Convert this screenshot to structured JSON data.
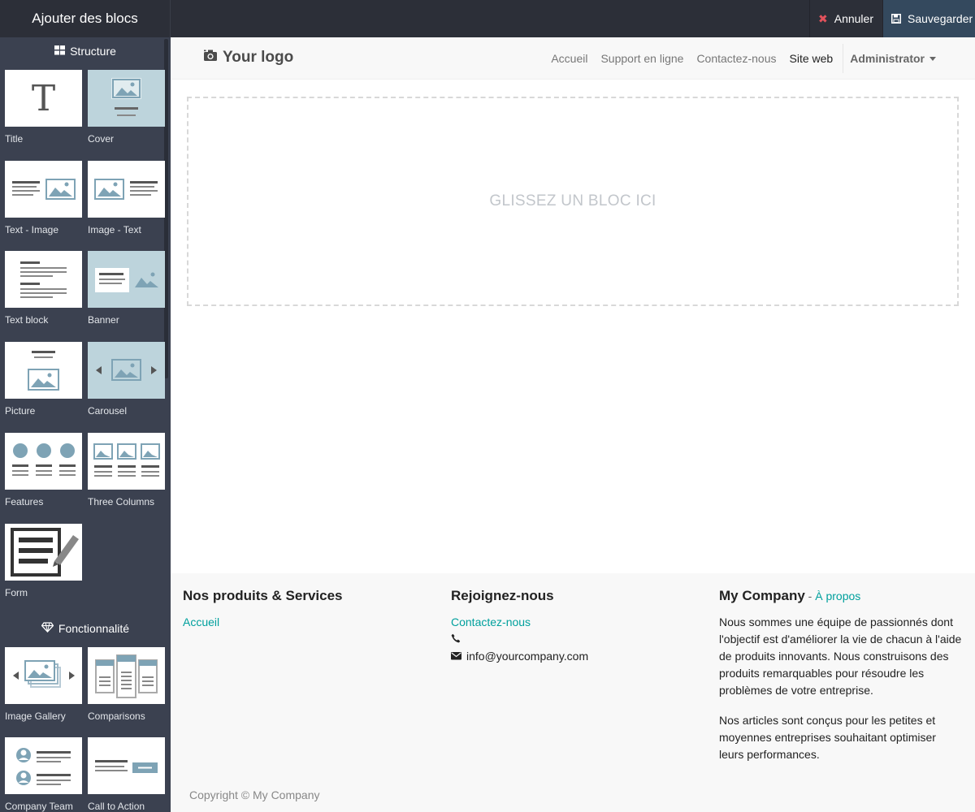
{
  "topbar": {
    "title": "Ajouter des blocs",
    "cancel_label": "Annuler",
    "save_label": "Sauvegarder",
    "cancel_icon_color": "#e2525c"
  },
  "sidebar": {
    "structure_heading": "Structure",
    "feature_heading": "Fonctionnalité",
    "structure_snippets": [
      {
        "label": "Title",
        "icon": "title-icon"
      },
      {
        "label": "Cover",
        "icon": "cover-icon"
      },
      {
        "label": "Text - Image",
        "icon": "text-image-icon"
      },
      {
        "label": "Image - Text",
        "icon": "image-text-icon"
      },
      {
        "label": "Text block",
        "icon": "text-block-icon"
      },
      {
        "label": "Banner",
        "icon": "banner-icon"
      },
      {
        "label": "Picture",
        "icon": "picture-icon"
      },
      {
        "label": "Carousel",
        "icon": "carousel-icon"
      },
      {
        "label": "Features",
        "icon": "features-icon"
      },
      {
        "label": "Three Columns",
        "icon": "three-columns-icon"
      },
      {
        "label": "Form",
        "icon": "form-icon"
      }
    ],
    "feature_snippets": [
      {
        "label": "Image Gallery",
        "icon": "image-gallery-icon"
      },
      {
        "label": "Comparisons",
        "icon": "comparisons-icon"
      },
      {
        "label": "Company Team",
        "icon": "company-team-icon"
      },
      {
        "label": "Call to Action",
        "icon": "call-to-action-icon"
      }
    ]
  },
  "navbar": {
    "logo_text": "Your logo",
    "links": [
      "Accueil",
      "Support en ligne",
      "Contactez-nous",
      "Site web"
    ],
    "user": "Administrator"
  },
  "dropzone": {
    "text": "GLISSEZ UN BLOC ICI"
  },
  "footer": {
    "col1": {
      "heading": "Nos produits & Services",
      "link": "Accueil"
    },
    "col2": {
      "heading": "Rejoignez-nous",
      "link": "Contactez-nous",
      "phone": "",
      "email": "info@yourcompany.com"
    },
    "col3": {
      "heading": "My Company",
      "separator": " - ",
      "about_link": "À propos",
      "paragraph1": "Nous sommes une équipe de passionnés dont l'objectif est d'améliorer la vie de chacun à l'aide de produits innovants. Nous construisons des produits remarquables pour résoudre les problèmes de votre entreprise.",
      "paragraph2": "Nos articles sont conçus pour les petites et moyennes entreprises souhaitant optimiser leurs performances."
    },
    "copyright": "Copyright © My Company",
    "link_color": "#00a09d"
  }
}
